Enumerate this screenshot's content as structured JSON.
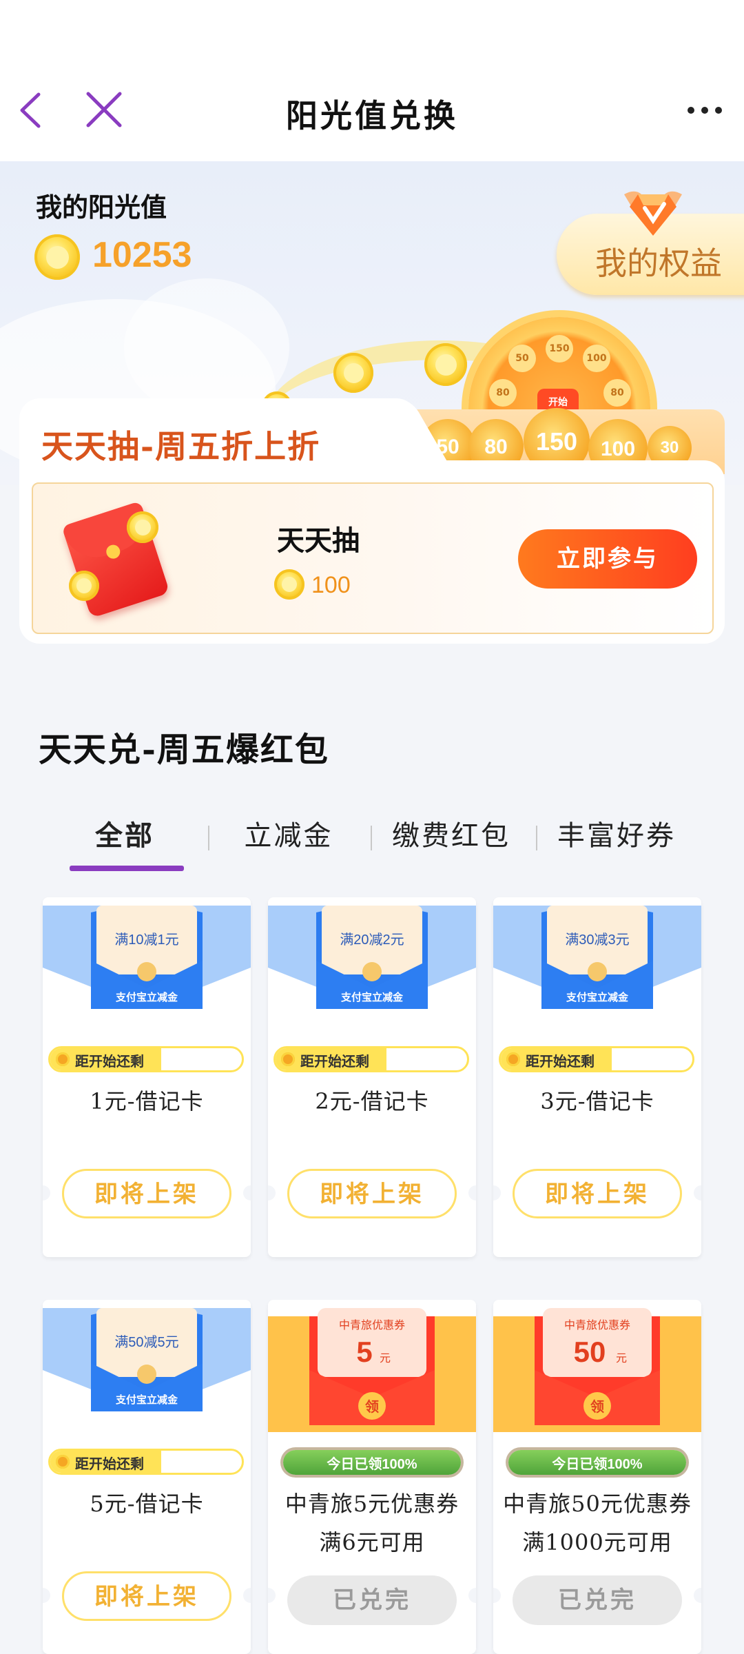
{
  "header": {
    "title": "阳光值兑换"
  },
  "balance": {
    "label": "我的阳光值",
    "value": "10253",
    "benefits_label": "我的权益"
  },
  "daily_draw": {
    "banner_title": "天天抽-周五折上折",
    "wheel_coins": [
      "50",
      "80",
      "150",
      "100",
      "30"
    ],
    "item_name": "天天抽",
    "cost": "100",
    "join_label": "立即参与"
  },
  "exchange": {
    "section_title": "天天兑-周五爆红包",
    "tabs": [
      {
        "label": "全部",
        "active": true
      },
      {
        "label": "立减金",
        "active": false
      },
      {
        "label": "缴费红包",
        "active": false
      },
      {
        "label": "丰富好券",
        "active": false
      }
    ],
    "items": [
      {
        "voucher_text": "满10减1元",
        "badge": "支付宝立减金",
        "status_text": "距开始还剩",
        "name": "1元-借记卡",
        "button": "即将上架"
      },
      {
        "voucher_text": "满20减2元",
        "badge": "支付宝立减金",
        "status_text": "距开始还剩",
        "name": "2元-借记卡",
        "button": "即将上架"
      },
      {
        "voucher_text": "满30减3元",
        "badge": "支付宝立减金",
        "status_text": "距开始还剩",
        "name": "3元-借记卡",
        "button": "即将上架"
      },
      {
        "voucher_text": "满50减5元",
        "badge": "支付宝立减金",
        "status_text": "距开始还剩",
        "name": "5元-借记卡",
        "button": "即将上架"
      },
      {
        "voucher_title": "中青旅优惠券",
        "voucher_amount": "5",
        "voucher_unit": "元",
        "seal": "领",
        "status_text": "今日已领100%",
        "name": "中青旅5元优惠券",
        "name2": "满6元可用",
        "button": "已兑完"
      },
      {
        "voucher_title": "中青旅优惠券",
        "voucher_amount": "50",
        "voucher_unit": "元",
        "seal": "领",
        "status_text": "今日已领100%",
        "name": "中青旅50元优惠券",
        "name2": "满1000元可用",
        "button": "已兑完"
      }
    ]
  },
  "colors": {
    "accent_purple": "#8a3cc0",
    "sun_orange": "#f6a12a",
    "join_red": "#ff3e1f"
  }
}
